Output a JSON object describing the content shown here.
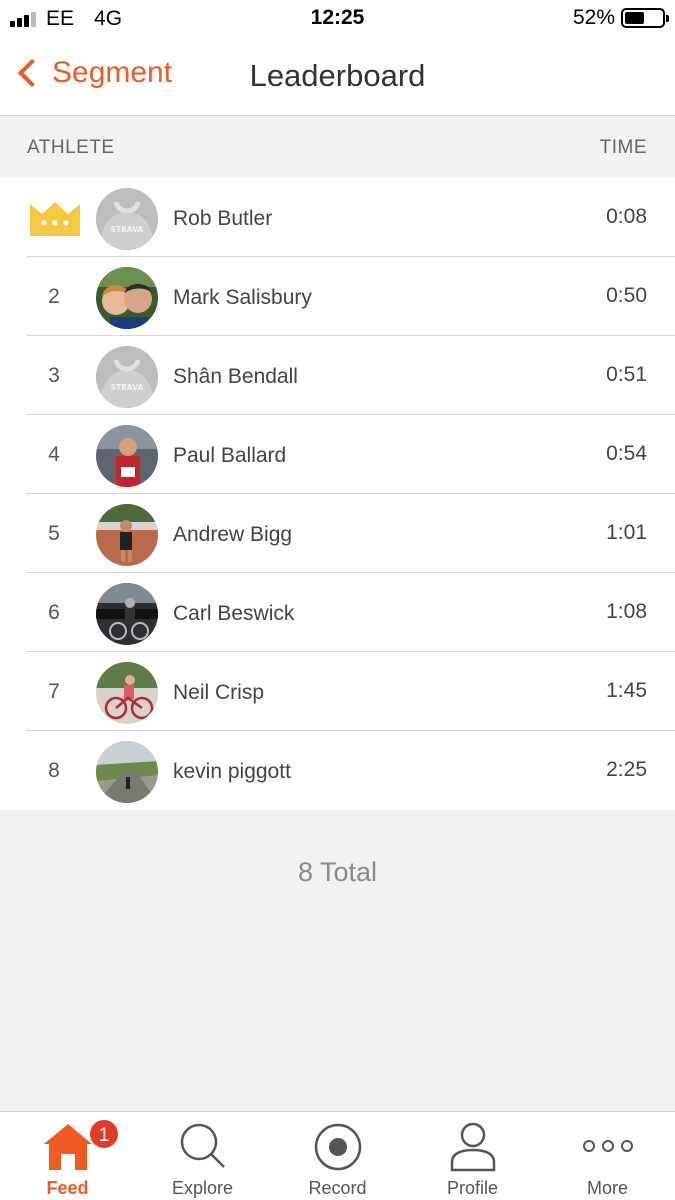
{
  "status_bar": {
    "carrier": "EE",
    "network": "4G",
    "time": "12:25",
    "battery": "52%",
    "battery_level": 0.52
  },
  "nav": {
    "back_label": "Segment",
    "title": "Leaderboard"
  },
  "table": {
    "col_athlete": "ATHLETE",
    "col_time": "TIME"
  },
  "leaderboard": [
    {
      "rank": "1",
      "name": "Rob Butler",
      "time": "0:08",
      "avatar": "placeholder"
    },
    {
      "rank": "2",
      "name": "Mark Salisbury",
      "time": "0:50",
      "avatar": "photo"
    },
    {
      "rank": "3",
      "name": "Shân Bendall",
      "time": "0:51",
      "avatar": "placeholder"
    },
    {
      "rank": "4",
      "name": "Paul Ballard",
      "time": "0:54",
      "avatar": "photo"
    },
    {
      "rank": "5",
      "name": "Andrew Bigg",
      "time": "1:01",
      "avatar": "photo"
    },
    {
      "rank": "6",
      "name": "Carl Beswick",
      "time": "1:08",
      "avatar": "photo"
    },
    {
      "rank": "7",
      "name": "Neil Crisp",
      "time": "1:45",
      "avatar": "photo"
    },
    {
      "rank": "8",
      "name": "kevin piggott",
      "time": "2:25",
      "avatar": "photo"
    }
  ],
  "total": "8 Total",
  "tabs": [
    {
      "label": "Feed",
      "icon": "home-icon",
      "active": true,
      "badge": "1"
    },
    {
      "label": "Explore",
      "icon": "search-icon"
    },
    {
      "label": "Record",
      "icon": "record-icon"
    },
    {
      "label": "Profile",
      "icon": "profile-icon"
    },
    {
      "label": "More",
      "icon": "more-icon"
    }
  ],
  "colors": {
    "accent": "#f05a24",
    "crown": "#f5c842",
    "badge": "#e23b2a"
  }
}
